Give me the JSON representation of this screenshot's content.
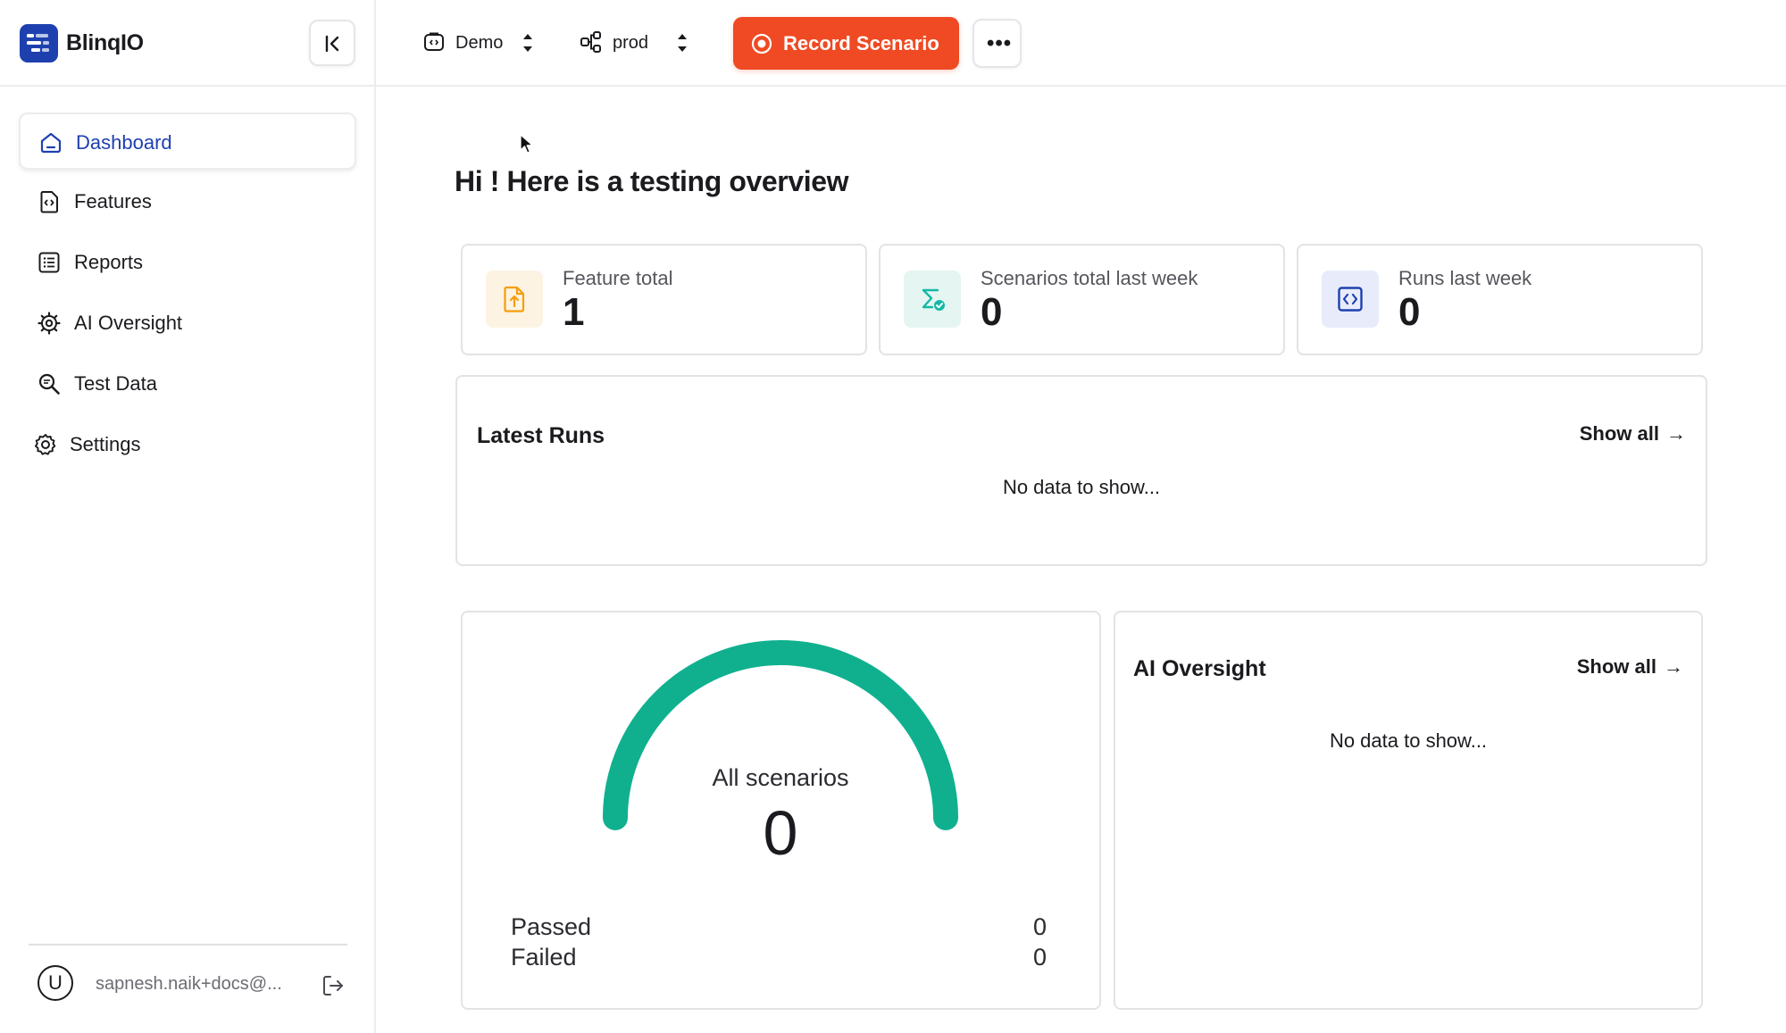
{
  "app": {
    "name": "BlinqIO"
  },
  "sidebar": {
    "items": [
      {
        "label": "Dashboard",
        "icon": "home-icon",
        "active": true
      },
      {
        "label": "Features",
        "icon": "file-code-icon",
        "active": false
      },
      {
        "label": "Reports",
        "icon": "list-icon",
        "active": false
      },
      {
        "label": "AI Oversight",
        "icon": "cog-chip-icon",
        "active": false
      },
      {
        "label": "Test Data",
        "icon": "search-data-icon",
        "active": false
      },
      {
        "label": "Settings",
        "icon": "gear-icon",
        "active": false
      }
    ],
    "user": {
      "initial": "U",
      "email": "sapnesh.naik+docs@..."
    }
  },
  "topbar": {
    "project": {
      "label": "Demo",
      "icon": "project-icon"
    },
    "environment": {
      "label": "prod",
      "icon": "environment-icon"
    },
    "record_label": "Record Scenario",
    "more_label": "•••"
  },
  "main": {
    "greeting": "Hi ! Here is a testing overview",
    "stats": [
      {
        "label": "Feature total",
        "value": "1",
        "icon": "file-upload-icon"
      },
      {
        "label": "Scenarios total last week",
        "value": "0",
        "icon": "scenario-check-icon"
      },
      {
        "label": "Runs last week",
        "value": "0",
        "icon": "code-box-icon"
      }
    ],
    "latest_runs": {
      "title": "Latest Runs",
      "show_all": "Show all",
      "empty": "No data to show..."
    },
    "scenarios": {
      "gauge_label": "All scenarios",
      "total": "0",
      "legend": [
        {
          "label": "Passed",
          "value": "0"
        },
        {
          "label": "Failed",
          "value": "0"
        }
      ]
    },
    "ai_oversight": {
      "title": "AI Oversight",
      "show_all": "Show all",
      "empty": "No data to show..."
    }
  },
  "colors": {
    "brand": "#1e40af",
    "record": "#ef4a23",
    "gauge": "#10b08f",
    "feature_icon": "#f59e0b",
    "scenario_icon": "#14b8a6"
  }
}
